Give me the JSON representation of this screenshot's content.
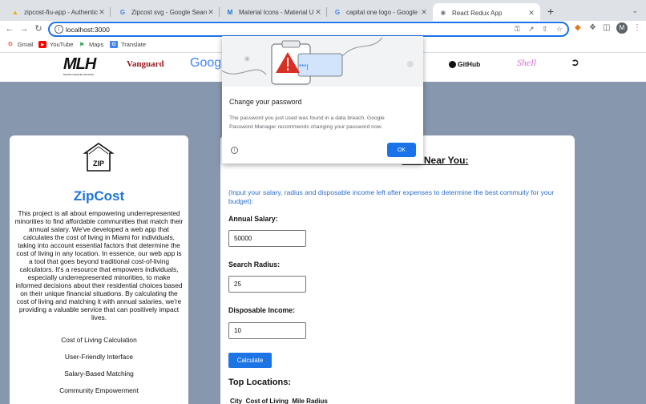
{
  "browser": {
    "tabs": [
      {
        "label": "zipcost-fiu-app - Authenticati",
        "icon": "fire-icon"
      },
      {
        "label": "Zipcost svg - Google Search",
        "icon": "google-icon"
      },
      {
        "label": "Material Icons - Material UI",
        "icon": "material-ui-icon"
      },
      {
        "label": "capital one logo - Google Sea",
        "icon": "google-icon"
      },
      {
        "label": "React Redux App",
        "icon": "react-icon",
        "active": true
      }
    ],
    "new_tab": "+",
    "address": "localhost:3000",
    "avatar_letter": "M",
    "bookmarks": [
      {
        "label": "Gmail",
        "icon": "gmail-icon"
      },
      {
        "label": "YouTube",
        "icon": "youtube-icon"
      },
      {
        "label": "Maps",
        "icon": "maps-icon"
      },
      {
        "label": "Translate",
        "icon": "translate-icon"
      }
    ]
  },
  "logos": {
    "mlh": "MLH",
    "mlh_sub": "MAJOR LEAGUE HACKING",
    "vanguard": "Vanguard",
    "google_partial": "Goog",
    "github": "GitHub",
    "shell": "Shell"
  },
  "left_card": {
    "icon_text": "ZIP",
    "brand": "ZipCost",
    "about": "This project is all about empowering underrepresented minorities to find affordable communities that match their annual salary. We've developed a web app that calculates the cost of living in Miami for individuals, taking into account essential factors that determine the cost of living in any location. In essence, our web app is a tool that goes beyond traditional cost-of-living calculators. It's a resource that empowers individuals, especially underrepresented minorities, to make informed decisions about their residential choices based on their unique financial situations. By calculating the cost of living and matching it with annual salaries, we're providing a valuable service that can positively impact lives.",
    "features": [
      "Cost of Living Calculation",
      "User-Friendly Interface",
      "Salary-Based Matching",
      "Community Empowerment"
    ]
  },
  "right_card": {
    "title_partial": "ities Near You:",
    "note": "(Input your salary, radius and disposable income left after expenses to determine the best commuity for your budget):",
    "salary_label": "Annual Salary:",
    "salary_value": "50000",
    "radius_label": "Search Radius:",
    "radius_value": "25",
    "income_label": "Disposable Income:",
    "income_value": "10",
    "calculate": "Calculate",
    "top_locations": "Top Locations:",
    "table_headers": [
      "City",
      "Cost of Living",
      "Mile Radius"
    ]
  },
  "dialog": {
    "title": "Change your password",
    "body": "The password you just used was found in a data breach. Google Password Manager recommends changing your password now.",
    "ok": "OK",
    "masked": "***|"
  },
  "colors": {
    "page_bg": "#8797ad",
    "brand_blue": "#1e73d8",
    "button_blue": "#1d74e5",
    "warning_red": "#d93025"
  }
}
